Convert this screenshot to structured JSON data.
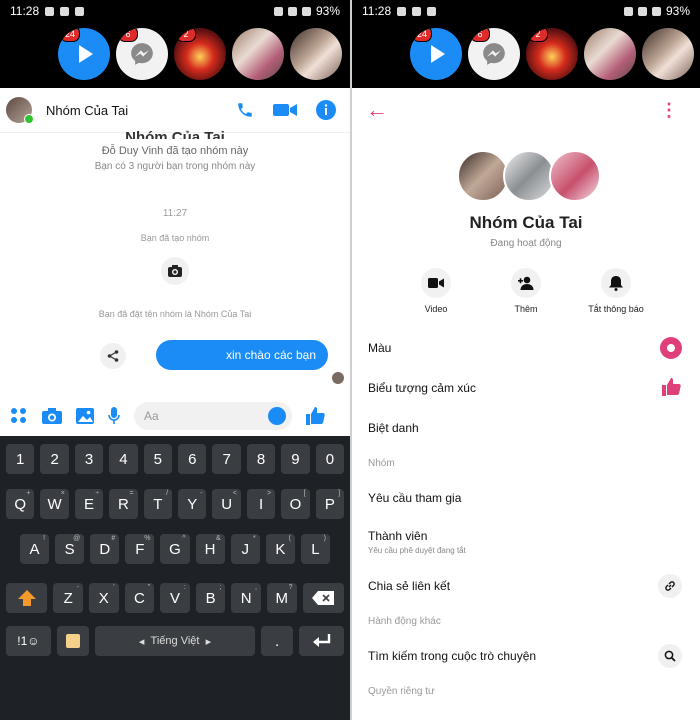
{
  "statusbar": {
    "time": "11:28",
    "battery": "93%"
  },
  "bubbles": {
    "badge1": "24",
    "badge2": "6",
    "badge3": "2"
  },
  "chat": {
    "title": "Nhóm Của Tai",
    "creator_line": "Đỗ Duy Vinh đã tạo nhóm này",
    "friends_line": "Bạn có 3 người bạn trong nhóm này",
    "time": "11:27",
    "created_line": "Bạn đã tạo nhóm",
    "renamed_line": "Bạn đã đặt tên nhóm là Nhóm Của Tai",
    "outgoing_message": "xin chào các bạn",
    "composer_placeholder": "Aa"
  },
  "keyboard": {
    "row_numbers": [
      "1",
      "2",
      "3",
      "4",
      "5",
      "6",
      "7",
      "8",
      "9",
      "0"
    ],
    "row_top": [
      {
        "k": "Q",
        "s": "+"
      },
      {
        "k": "W",
        "s": "×"
      },
      {
        "k": "E",
        "s": "÷"
      },
      {
        "k": "R",
        "s": "="
      },
      {
        "k": "T",
        "s": "/"
      },
      {
        "k": "Y",
        "s": "-"
      },
      {
        "k": "U",
        "s": "<"
      },
      {
        "k": "I",
        "s": ">"
      },
      {
        "k": "O",
        "s": "["
      },
      {
        "k": "P",
        "s": "]"
      }
    ],
    "row_mid": [
      {
        "k": "A",
        "s": "!"
      },
      {
        "k": "S",
        "s": "@"
      },
      {
        "k": "D",
        "s": "#"
      },
      {
        "k": "F",
        "s": "%"
      },
      {
        "k": "G",
        "s": "^"
      },
      {
        "k": "H",
        "s": "&"
      },
      {
        "k": "J",
        "s": "*"
      },
      {
        "k": "K",
        "s": "("
      },
      {
        "k": "L",
        "s": ")"
      }
    ],
    "row_bottom": [
      {
        "k": "Z",
        "s": "-"
      },
      {
        "k": "X",
        "s": "'"
      },
      {
        "k": "C",
        "s": "\""
      },
      {
        "k": "V",
        "s": ":"
      },
      {
        "k": "B",
        "s": ";"
      },
      {
        "k": "N",
        "s": ","
      },
      {
        "k": "M",
        "s": "?"
      }
    ],
    "symbols_label": "!1☺",
    "space_label": "Tiếng Việt",
    "period_label": "."
  },
  "settings": {
    "group_name": "Nhóm Của Tai",
    "status": "Đang hoạt động",
    "actions": {
      "video": "Video",
      "add": "Thêm",
      "mute": "Tắt thông báo"
    },
    "color": "Màu",
    "emoji": "Biểu tượng cảm xúc",
    "nicknames": "Biệt danh",
    "section_group": "Nhóm",
    "join_requests": "Yêu cầu tham gia",
    "members": "Thành viên",
    "members_sub": "Yêu cầu phê duyệt đang tắt",
    "share_link": "Chia sẻ liên kết",
    "section_other": "Hành động khác",
    "search": "Tìm kiếm trong cuộc trò chuyện",
    "section_privacy": "Quyền riêng tư"
  },
  "colors": {
    "accent_blue": "#1b8cf5",
    "accent_pink": "#e0407a"
  }
}
